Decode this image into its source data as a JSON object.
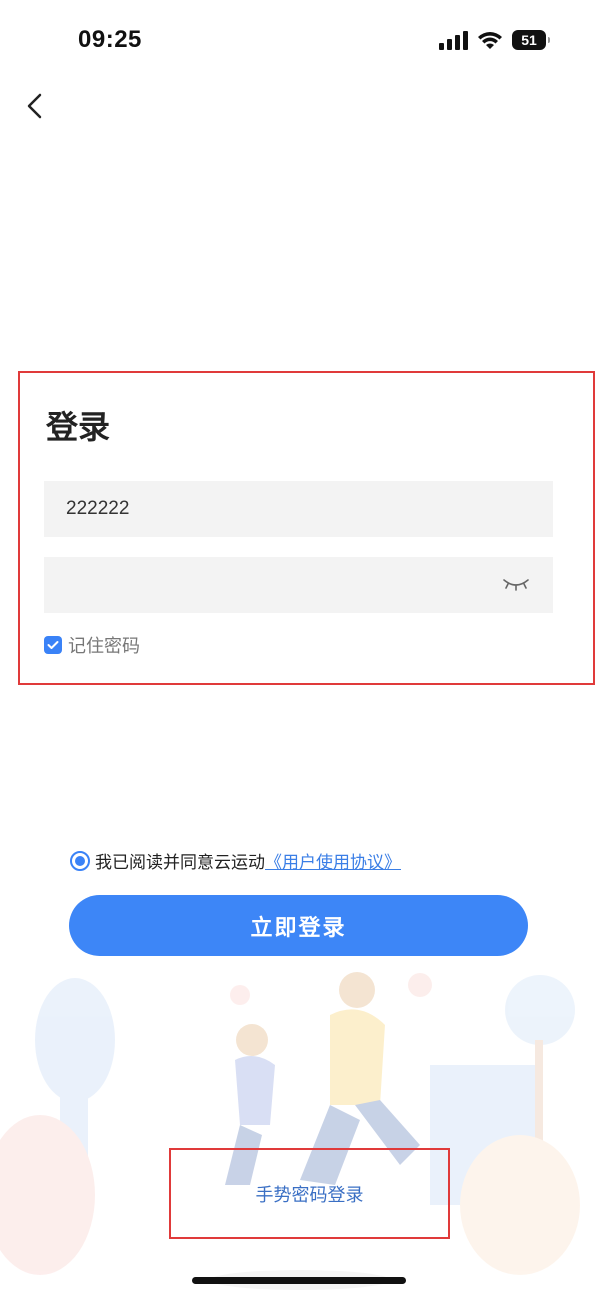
{
  "status_bar": {
    "time": "09:25",
    "battery": "51",
    "icons": [
      "signal-icon",
      "wifi-icon",
      "battery-icon"
    ]
  },
  "nav": {
    "back_icon": "chevron-left-icon"
  },
  "login_form": {
    "title": "登录",
    "username_value": "222222",
    "password_value": "",
    "password_toggle_icon": "eye-closed-icon",
    "remember_label": "记住密码",
    "remember_checked": true
  },
  "agreement": {
    "text": "我已阅读并同意云运动",
    "link": "《用户使用协议》",
    "checked": true
  },
  "actions": {
    "login_button": "立即登录",
    "gesture_login": "手势密码登录"
  },
  "colors": {
    "accent": "#3d86f7",
    "annotation": "#e03a3a",
    "field_bg": "#f3f3f3"
  }
}
